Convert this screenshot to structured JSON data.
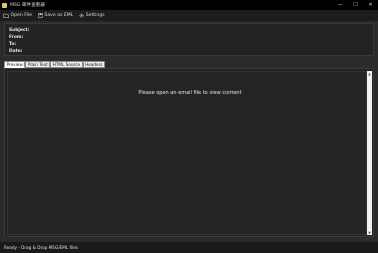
{
  "window": {
    "title": "MSG 邮件查看器",
    "minimize_glyph": "—",
    "maximize_glyph": "☐",
    "close_glyph": "✕"
  },
  "toolbar": {
    "open_label": "Open File",
    "save_label": "Save as EML",
    "settings_label": "Settings"
  },
  "headers": {
    "subject_label": "Subject:",
    "from_label": "From:",
    "to_label": "To:",
    "date_label": "Date:"
  },
  "tabs": [
    {
      "label": "Preview"
    },
    {
      "label": "Plain Text"
    },
    {
      "label": "HTML Source"
    },
    {
      "label": "Headers"
    }
  ],
  "content": {
    "placeholder": "Please open an email file to view content"
  },
  "status": {
    "text": "Ready - Drag & Drop MSG/EML files"
  },
  "colors": {
    "background": "#2b2b2b",
    "titlebar": "#000000",
    "toolbar": "#1c1c1c",
    "panel": "#232323"
  }
}
